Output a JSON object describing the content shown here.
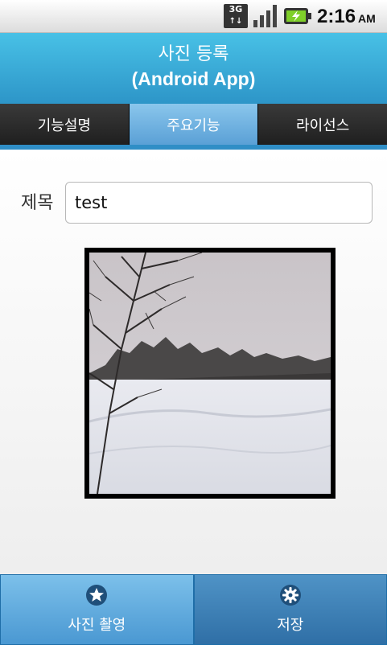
{
  "status_bar": {
    "network_label": "3G",
    "time": "2:16",
    "ampm": "AM",
    "icons": [
      "3g-icon",
      "signal-icon",
      "battery-charging-icon"
    ]
  },
  "title_bar": {
    "line1": "사진 등록",
    "line2": "(Android App)"
  },
  "tabs": [
    {
      "label": "기능설명",
      "active": false
    },
    {
      "label": "주요기능",
      "active": true
    },
    {
      "label": "라이선스",
      "active": false
    }
  ],
  "form": {
    "title_label": "제목",
    "title_value": "test"
  },
  "photo": {
    "description": "snowy field with bare trees"
  },
  "bottom_bar": {
    "shoot_label": "사진 촬영",
    "shoot_icon": "star-icon",
    "save_label": "저장",
    "save_icon": "gear-icon"
  },
  "colors": {
    "accent": "#2f8ec6",
    "title_top": "#48c1e6",
    "title_bottom": "#2d95c8",
    "tab_active": "#6fb2e2"
  }
}
